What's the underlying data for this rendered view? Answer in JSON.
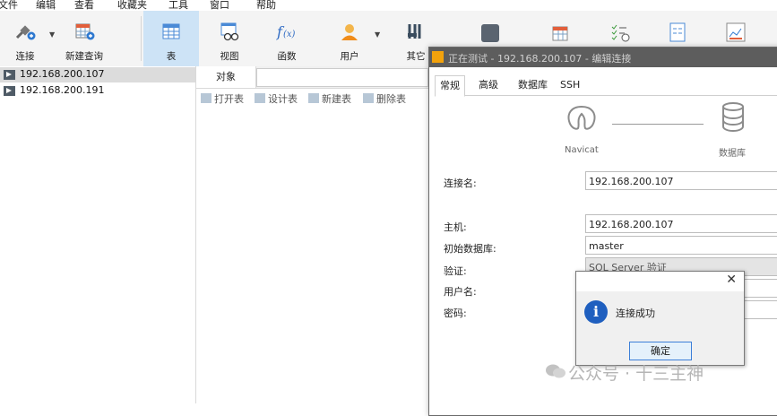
{
  "menu": [
    "文件",
    "编辑",
    "查看",
    "收藏夹",
    "工具",
    "窗口",
    "帮助"
  ],
  "toolbar": {
    "connect": "连接",
    "new_query": "新建查询",
    "table": "表",
    "view": "视图",
    "function": "函数",
    "user": "用户",
    "other": "其它"
  },
  "connections": [
    "192.168.200.107",
    "192.168.200.191"
  ],
  "object_panel": {
    "tab": "对象",
    "actions": [
      "打开表",
      "设计表",
      "新建表",
      "删除表"
    ]
  },
  "dialog": {
    "title": "正在测试 - 192.168.200.107 - 编辑连接",
    "tabs": [
      "常规",
      "高级",
      "数据库",
      "SSH"
    ],
    "diagram_left": "Navicat",
    "diagram_right": "数据库",
    "labels": {
      "conn_name": "连接名:",
      "host": "主机:",
      "initial_db": "初始数据库:",
      "auth": "验证:",
      "username": "用户名:",
      "password": "密码:"
    },
    "values": {
      "conn_name": "192.168.200.107",
      "host": "192.168.200.107",
      "initial_db": "master",
      "auth": "SQL Server 验证"
    }
  },
  "message": {
    "text": "连接成功",
    "ok": "确定",
    "close": "✕"
  },
  "watermark": "公众号 · 十三主神",
  "colors": {
    "accent": "#1f5fbf",
    "active_tool": "#cde3f6",
    "title_bar": "#5d5d5d"
  }
}
